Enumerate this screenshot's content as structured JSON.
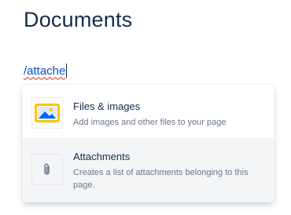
{
  "page": {
    "title": "Documents"
  },
  "editor": {
    "slash_command_text": "/attache"
  },
  "menu": {
    "items": [
      {
        "title": "Files & images",
        "description": "Add images and other files to your page",
        "icon": "image-icon",
        "selected": false
      },
      {
        "title": "Attachments",
        "description": "Creates a list of attachments belonging to this page.",
        "icon": "paperclip-icon",
        "selected": true
      }
    ]
  },
  "colors": {
    "title_text": "#172b4d",
    "query_text": "#0052cc",
    "spellcheck_underline": "#de350b",
    "selected_item_bg": "#f4f5f7",
    "image_icon_bg": "#ffc400",
    "image_icon_fg": "#0065ff"
  }
}
